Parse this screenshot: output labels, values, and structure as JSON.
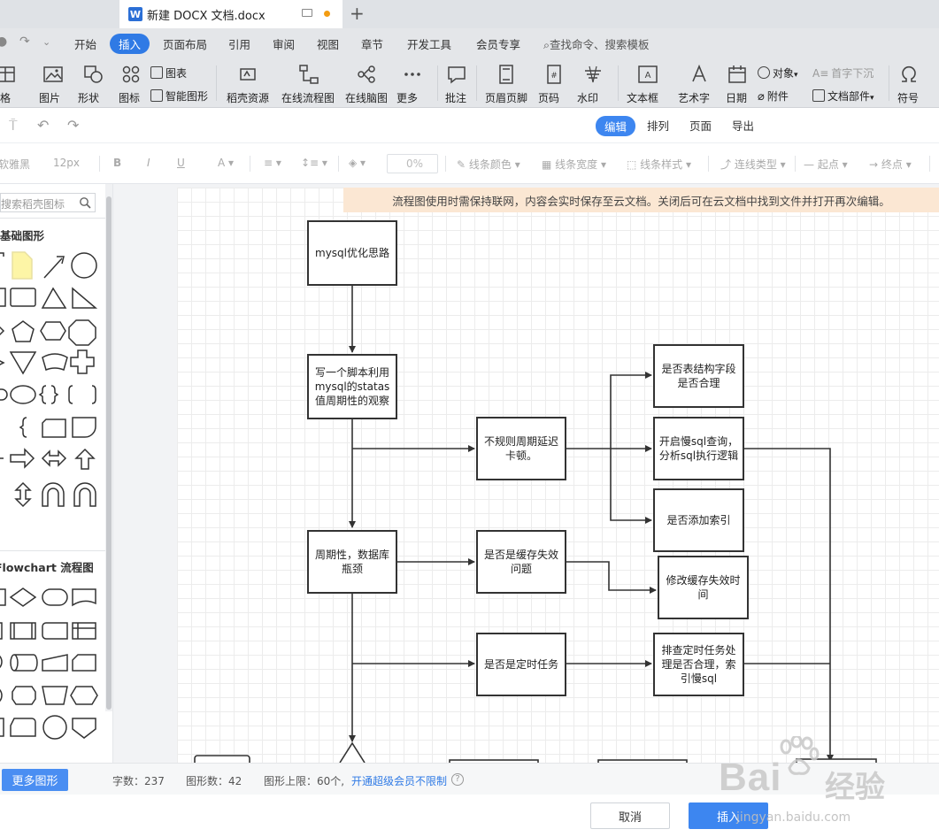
{
  "tabbar": {
    "doc_title": "新建 DOCX 文档.docx",
    "app_letter": "W",
    "new_tab": "+"
  },
  "menu": {
    "items": [
      "开始",
      "插入",
      "页面布局",
      "引用",
      "审阅",
      "视图",
      "章节",
      "开发工具",
      "会员专享"
    ],
    "active": "插入",
    "search_placeholder": "查找命令、搜索模板"
  },
  "ribbon": {
    "items": [
      "格",
      "图片",
      "形状",
      "图标",
      "稻壳资源",
      "在线流程图",
      "在线脑图",
      "更多",
      "批注",
      "页眉页脚",
      "页码",
      "水印",
      "文本框",
      "艺术字",
      "日期",
      "符号"
    ],
    "small": [
      "图表",
      "智能图形",
      "对象",
      "附件",
      "首字下沉",
      "文档部件"
    ]
  },
  "editor": {
    "modes": [
      "编辑",
      "排列",
      "页面",
      "导出"
    ],
    "active_mode": "编辑",
    "font_name": "微软雅黑",
    "font_size": "12px",
    "opacity": "0%",
    "line_color": "线条颜色",
    "line_width": "线条宽度",
    "line_style": "线条样式",
    "connector_type": "连线类型",
    "start_point": "起点",
    "end_point": "终点"
  },
  "panel": {
    "search_placeholder": "搜索稻壳图标",
    "section_basic": "基础图形",
    "section_flowchart": "Flowchart 流程图"
  },
  "notice": "流程图使用时需保持联网，内容会实时保存至云文档。关闭后可在云文档中找到文件并打开再次编辑。",
  "flowchart": {
    "nodes": [
      "mysql优化思路",
      "写一个脚本利用mysql的statas值周期性的观察",
      "不规则周期延迟卡顿。",
      "是否表结构字段是否合理",
      "开启慢sql查询，分析sql执行逻辑",
      "是否添加索引",
      "周期性，数据库瓶颈",
      "是否是缓存失效问题",
      "修改缓存失效时间",
      "是否是定时任务",
      "排查定时任务处理是否合理，索引慢sql"
    ]
  },
  "status": {
    "more_shapes": "更多图形",
    "word_count": "字数：237",
    "shape_count": "图形数：42",
    "shape_limit": "图形上限：60个,",
    "upgrade_link": "开通超级会员不限制",
    "help": "?"
  },
  "buttons": {
    "cancel": "取消",
    "insert": "插入"
  },
  "watermark": {
    "brand": "Bai",
    "brand_cn": "经验",
    "url": "jingyan.baidu.com"
  }
}
